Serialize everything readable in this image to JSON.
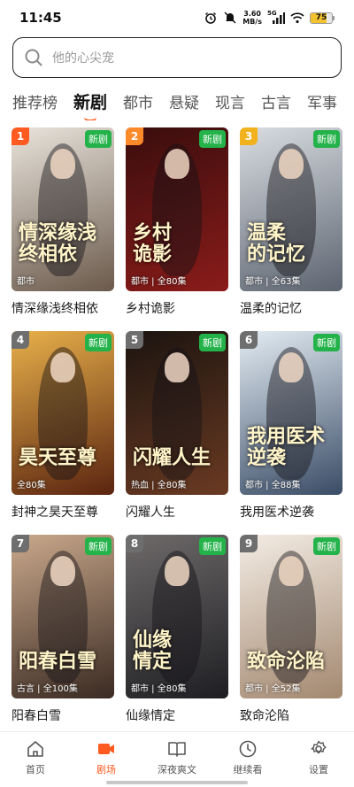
{
  "status_bar": {
    "time": "11:45",
    "net_speed_value": "3.60",
    "net_speed_unit": "MB/s",
    "signal_label": "5G",
    "battery_level": "75",
    "battery_fraction": 0.75,
    "icons": [
      "alarm-icon",
      "mute-icon",
      "signal-icon",
      "wifi-icon",
      "battery-icon"
    ]
  },
  "search": {
    "placeholder": "他的心尖宠"
  },
  "tabs": [
    {
      "label": "推荐榜",
      "active": false
    },
    {
      "label": "新剧",
      "active": true
    },
    {
      "label": "都市",
      "active": false
    },
    {
      "label": "悬疑",
      "active": false
    },
    {
      "label": "现言",
      "active": false
    },
    {
      "label": "古言",
      "active": false
    },
    {
      "label": "军事",
      "active": false
    }
  ],
  "colors": {
    "accent": "#ff5a1f",
    "new_badge": "#24b24a",
    "rank_1": "#ff5a1f",
    "rank_2": "#ff8a2a",
    "rank_3": "#f2b21e",
    "rank_other": "#6e6e6e"
  },
  "new_badge_label": "新剧",
  "cards": [
    {
      "rank": "1",
      "title": "情深缘浅终相依",
      "meta": "都市",
      "art": "情深缘浅\n终相依",
      "bg": [
        "#e9e4dc",
        "#6b5a4c"
      ]
    },
    {
      "rank": "2",
      "title": "乡村诡影",
      "meta": "都市 | 全80集",
      "art": "乡村\n诡影",
      "bg": [
        "#3a0d0d",
        "#8a1c1a"
      ]
    },
    {
      "rank": "3",
      "title": "温柔的记忆",
      "meta": "都市 | 全63集",
      "art": "温柔\n的记忆",
      "bg": [
        "#d9dde2",
        "#5c6470"
      ]
    },
    {
      "rank": "4",
      "title": "封神之昊天至尊",
      "meta": "全80集",
      "art": "昊天至尊",
      "bg": [
        "#e8b04a",
        "#5a2410"
      ]
    },
    {
      "rank": "5",
      "title": "闪耀人生",
      "meta": "热血 | 全80集",
      "art": "闪耀人生",
      "bg": [
        "#1c1410",
        "#6a3a22"
      ]
    },
    {
      "rank": "6",
      "title": "我用医术逆袭",
      "meta": "都市 | 全88集",
      "art": "我用医术逆袭",
      "bg": [
        "#e3ecf3",
        "#3a4c66"
      ]
    },
    {
      "rank": "7",
      "title": "阳春白雪",
      "meta": "古言 | 全100集",
      "art": "阳春白雪",
      "bg": [
        "#caa98c",
        "#3a2a22"
      ]
    },
    {
      "rank": "8",
      "title": "仙缘情定",
      "meta": "都市 | 全80集",
      "art": "仙缘\n情定",
      "bg": [
        "#6e6a6a",
        "#1e1e22"
      ]
    },
    {
      "rank": "9",
      "title": "致命沦陷",
      "meta": "都市 | 全52集",
      "art": "致命沦陷",
      "bg": [
        "#f3ece4",
        "#a38870"
      ]
    }
  ],
  "bottom_nav": [
    {
      "label": "首页",
      "icon": "home-icon",
      "active": false
    },
    {
      "label": "剧场",
      "icon": "video-icon",
      "active": true
    },
    {
      "label": "深夜爽文",
      "icon": "book-icon",
      "active": false
    },
    {
      "label": "继续看",
      "icon": "clock-icon",
      "active": false
    },
    {
      "label": "设置",
      "icon": "gear-icon",
      "active": false
    }
  ]
}
